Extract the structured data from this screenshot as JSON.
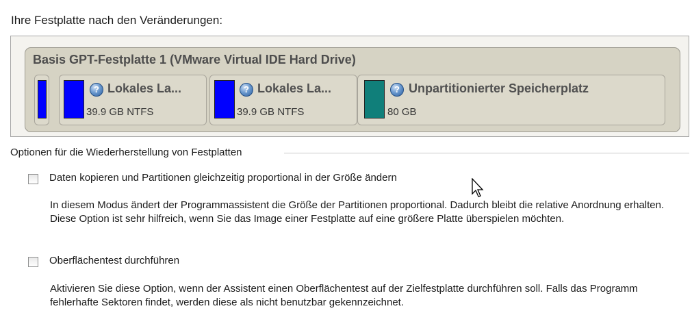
{
  "disk_section": {
    "label": "Ihre Festplatte nach den Veränderungen:",
    "disk_title": "Basis GPT-Festplatte 1 (VMware Virtual IDE Hard Drive)",
    "partitions": [
      {
        "name": "Lokales La...",
        "size": "39.9 GB NTFS",
        "color": "#0000ff",
        "icon": "help-icon"
      },
      {
        "name": "Lokales La...",
        "size": "39.9 GB NTFS",
        "color": "#0000ff",
        "icon": "help-icon"
      },
      {
        "name": "Unpartitionierter Speicherplatz",
        "size": "80 GB",
        "color": "#107f7a",
        "icon": "help-icon"
      }
    ],
    "small_partition_color": "#0000ff"
  },
  "options": {
    "group_label": "Optionen für die Wiederherstellung von Festplatten",
    "items": [
      {
        "label": "Daten kopieren und Partitionen gleichzeitig proportional in der Größe ändern",
        "checked": false,
        "description": "In diesem Modus ändert der Programmassistent die Größe der Partitionen proportional. Dadurch bleibt die relative Anordnung erhalten. Diese Option ist sehr hilfreich, wenn Sie das Image einer Festplatte auf eine größere Platte überspielen möchten."
      },
      {
        "label": "Oberflächentest durchführen",
        "checked": false,
        "description": "Aktivieren Sie diese Option, wenn der Assistent einen Oberflächentest auf der Zielfestplatte durchführen soll. Falls das Programm fehlerhafte Sektoren findet, werden diese als nicht benutzbar gekennzeichnet."
      }
    ]
  }
}
